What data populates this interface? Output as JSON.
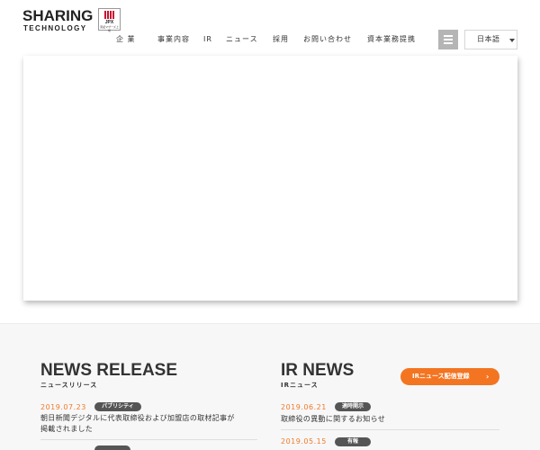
{
  "brand": {
    "logo_line1": "SHARING",
    "logo_line2": "TECHNOLOGY",
    "jpx_text": "JPX",
    "jpx_sub": "東証マザーズ上場"
  },
  "nav": {
    "items": [
      "企 業",
      "事業内容",
      "IR",
      "ニュース",
      "採用",
      "お問い合わせ",
      "資本業務提携"
    ]
  },
  "language": {
    "selected": "日本語"
  },
  "news_release": {
    "title": "NEWS RELEASE",
    "subtitle": "ニュースリリース",
    "items": [
      {
        "date": "2019.07.23",
        "tag": "パブリシティ",
        "lines": [
          "朝日新聞デジタルに代表取締役および加盟店の取材記事が",
          "掲載されました"
        ]
      }
    ]
  },
  "ir_news": {
    "title": "IR NEWS",
    "subtitle": "IRニュース",
    "button_label": "IRニュース配信登録",
    "button_arrow": "›",
    "items": [
      {
        "date": "2019.06.21",
        "tag": "適時開示",
        "lines": [
          "取締役の異動に関するお知らせ"
        ]
      },
      {
        "date": "2019.05.15",
        "tag": "有報",
        "lines": [
          ""
        ]
      }
    ]
  },
  "colors": {
    "accent": "#f37521",
    "date": "#f07a2b",
    "tag_bg": "#555555",
    "jpx_red": "#c8102e"
  },
  "icons": {
    "menu": "hamburger-icon",
    "language_caret": "caret-down-icon",
    "button_arrow": "chevron-right-icon"
  }
}
